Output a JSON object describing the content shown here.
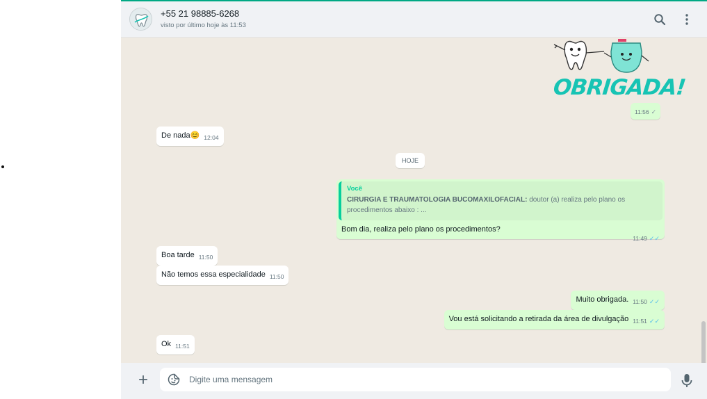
{
  "contact": {
    "name": "+55 21 98885-6268",
    "status": "visto por último hoje às 11:53"
  },
  "messages": {
    "sticker": {
      "text": "OBRIGADA!",
      "time": "11:56",
      "tick": "✓"
    },
    "m1": {
      "text": "De nada",
      "emoji": "😊",
      "time": "12:04"
    },
    "date_chip": "HOJE",
    "m2": {
      "quote_author": "Você",
      "quote_bold": "CIRURGIA E TRAUMATOLOGIA BUCOMAXILOFACIAL:",
      "quote_text": " doutor (a) realiza pelo plano os procedimentos abaixo :    ...",
      "text": "Bom dia, realiza pelo plano os procedimentos?",
      "time": "11:49",
      "tick": "✓✓"
    },
    "m3": {
      "text": "Boa tarde",
      "time": "11:50"
    },
    "m4": {
      "text": "Não temos essa especialidade",
      "time": "11:50"
    },
    "m5": {
      "text": "Muito obrigada.",
      "time": "11:50",
      "tick": "✓✓"
    },
    "m6": {
      "text": "Vou está solicitando a retirada da área de divulgação",
      "time": "11:51",
      "tick": "✓✓"
    },
    "m7": {
      "text": "Ok",
      "time": "11:51"
    }
  },
  "composer": {
    "placeholder": "Digite uma mensagem"
  },
  "icons": {
    "search": "search-icon",
    "menu": "menu-icon",
    "attach": "plus-icon",
    "emoji": "sticker-icon",
    "mic": "mic-icon"
  },
  "colors": {
    "accent": "#00a884",
    "outgoing_bubble": "#d9fdd3",
    "incoming_bubble": "#ffffff",
    "chat_bg": "#efeae2",
    "read_tick": "#53bdeb",
    "sticker_text": "#17c4b4"
  }
}
